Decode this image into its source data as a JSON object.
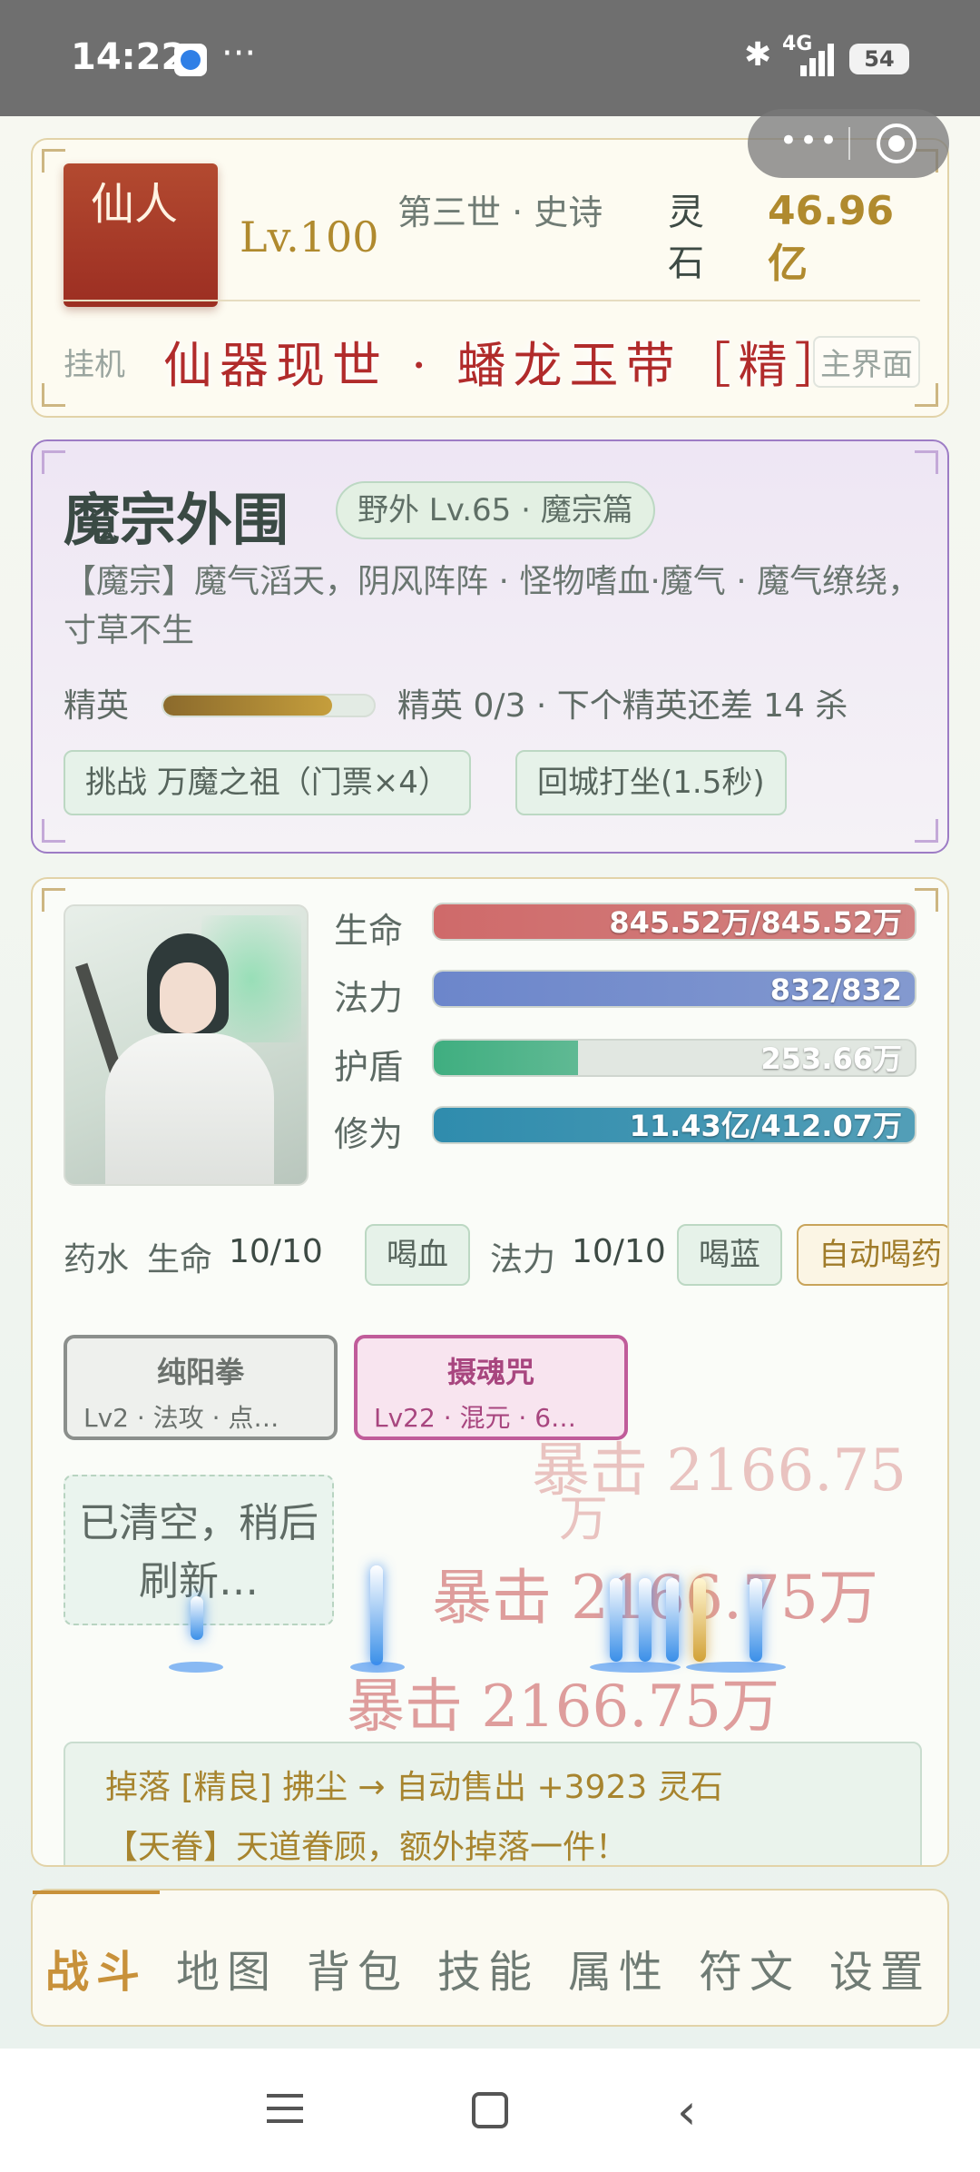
{
  "status_bar": {
    "time": "14:22",
    "more": "···",
    "network": "4G",
    "battery": "54"
  },
  "header": {
    "rank": "仙人",
    "level": "Lv.100",
    "era": "第三世 · 史诗",
    "stone_label": "灵石",
    "stone_value": "46.96亿",
    "afk": "挂机",
    "main_button": "主界面",
    "banner": "仙器现世 · 蟠龙玉带［精］"
  },
  "zone": {
    "title": "魔宗外围",
    "tag": "野外 Lv.65 · 魔宗篇",
    "description": "【魔宗】魔气滔天，阴风阵阵 · 怪物嗜血·魔气 · 魔气缭绕，寸草不生",
    "elite_label": "精英",
    "elite_progress": 0.8,
    "elite_text": "精英 0/3 · 下个精英还差 14 杀",
    "buttons": [
      "挑战 万魔之祖（门票×4）",
      "回城打坐(1.5秒)"
    ]
  },
  "stats": [
    {
      "label": "生命",
      "value": "845.52万/845.52万",
      "fill": 1.0,
      "color": "#cf6a6a"
    },
    {
      "label": "法力",
      "value": "832/832",
      "fill": 1.0,
      "color": "#6c86cb"
    },
    {
      "label": "护盾",
      "value": "253.66万",
      "fill": 0.3,
      "color": "#3fae80"
    },
    {
      "label": "修为",
      "value": "11.43亿/412.07万",
      "fill": 1.0,
      "color": "#2f8cad"
    }
  ],
  "potions": {
    "label": "药水",
    "hp_label": "生命",
    "hp_count": "10/10",
    "hp_button": "喝血",
    "mp_label": "法力",
    "mp_count": "10/10",
    "mp_button": "喝蓝",
    "auto_button": "自动喝药"
  },
  "skills": [
    {
      "name": "纯阳拳",
      "meta": "Lv2 · 法攻 · 点…"
    },
    {
      "name": "摄魂咒",
      "meta": "Lv22 · 混元 · 6…"
    }
  ],
  "battle": {
    "cleared": "已清空，稍后刷新…",
    "crit_top": "暴击 2166.75",
    "crit_top_unit": "万",
    "crit_mid": "暴击 2166.75万",
    "crit_bottom": "暴击 2166.75万"
  },
  "log": [
    "掉落 [精良] 拂尘 → 自动售出 +3923 灵石",
    "【天眷】天道眷顾，额外掉落一件！"
  ],
  "nav": [
    "战斗",
    "地图",
    "背包",
    "技能",
    "属性",
    "符文",
    "设置"
  ]
}
